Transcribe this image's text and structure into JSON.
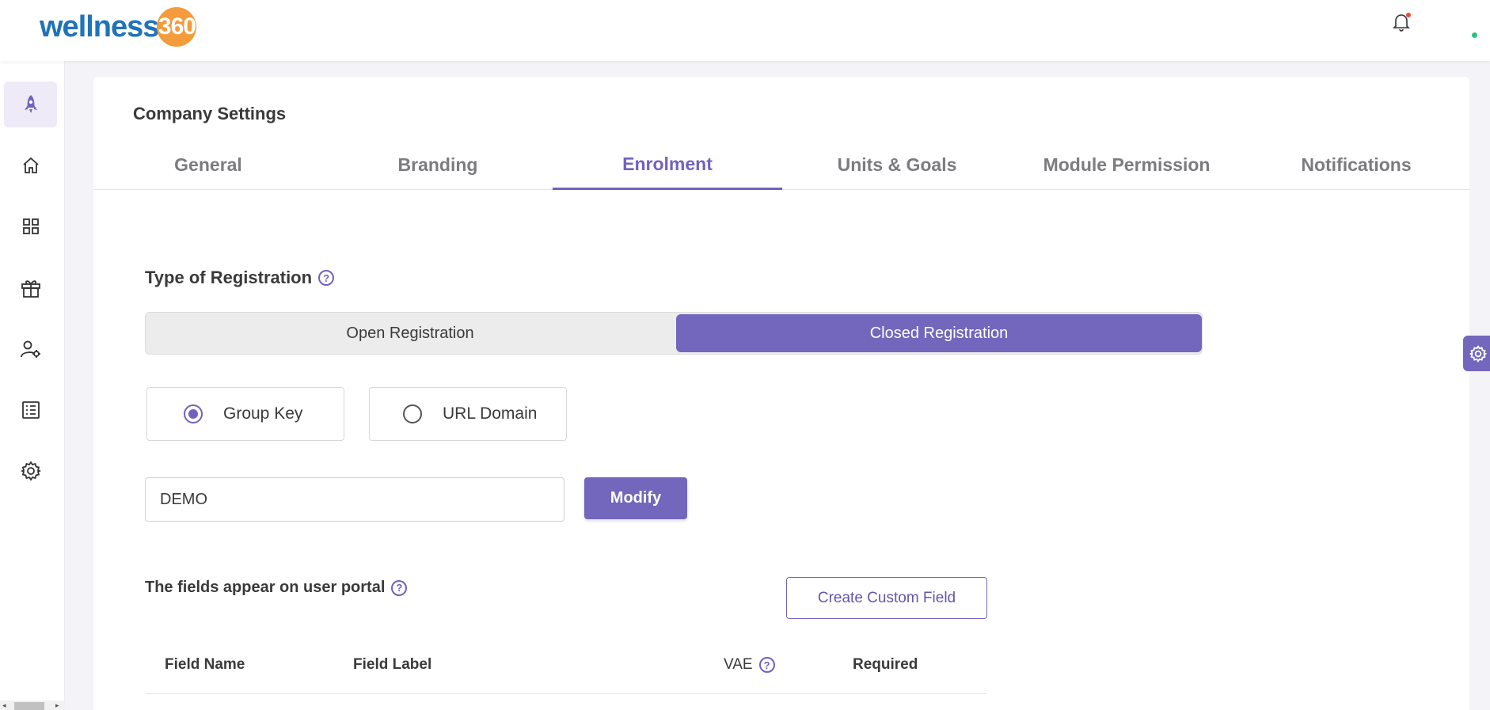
{
  "brand": {
    "name": "wellness",
    "suffix": "360"
  },
  "header": {
    "notification_icon": "bell-icon",
    "avatar_icon": "user-avatar"
  },
  "sidebar": {
    "items": [
      {
        "icon": "rocket-icon",
        "active": true
      },
      {
        "icon": "home-icon",
        "active": false
      },
      {
        "icon": "grid-icon",
        "active": false
      },
      {
        "icon": "gift-icon",
        "active": false
      },
      {
        "icon": "user-settings-icon",
        "active": false
      },
      {
        "icon": "list-icon",
        "active": false
      },
      {
        "icon": "gear-icon",
        "active": false
      }
    ]
  },
  "page": {
    "title": "Company Settings",
    "tabs": [
      {
        "label": "General"
      },
      {
        "label": "Branding"
      },
      {
        "label": "Enrolment",
        "active": true
      },
      {
        "label": "Units & Goals"
      },
      {
        "label": "Module Permission"
      },
      {
        "label": "Notifications"
      }
    ]
  },
  "enrolment": {
    "registration_title": "Type of Registration",
    "registration_options": {
      "open": "Open Registration",
      "closed": "Closed Registration",
      "selected": "Closed Registration"
    },
    "method_options": {
      "group_key": "Group Key",
      "url_domain": "URL Domain",
      "selected": "Group Key"
    },
    "group_key_value": "DEMO",
    "modify_label": "Modify",
    "fields_title": "The fields appear on user portal",
    "create_custom_field_label": "Create Custom Field",
    "table_headers": {
      "field_name": "Field Name",
      "field_label": "Field Label",
      "vae": "VAE",
      "required": "Required"
    }
  },
  "colors": {
    "accent": "#7266bd",
    "brand_blue": "#1f74b8",
    "brand_orange": "#f49b3b"
  }
}
